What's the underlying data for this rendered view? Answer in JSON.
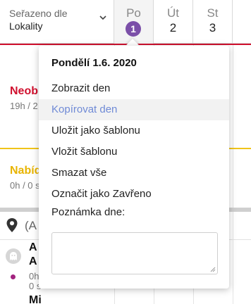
{
  "sort": {
    "label": "Seřazeno dle",
    "value": "Lokality"
  },
  "days": [
    {
      "name": "Po",
      "number": "1"
    },
    {
      "name": "Út",
      "number": "2"
    },
    {
      "name": "St",
      "number": "3"
    }
  ],
  "colors": {
    "accent_purple": "#7b4fa8",
    "red": "#d0102e",
    "yellow": "#f0c419",
    "menu_hover_text": "#6f8ad6"
  },
  "rows": {
    "red_title": "Neob",
    "red_sub": "19h / 2",
    "yellow_title": "Nabíd",
    "yellow_sub": "0h / 0 s"
  },
  "location": {
    "text": "(A"
  },
  "employee": {
    "name_line1": "A",
    "name_line2": "A",
    "sub1": "0h",
    "sub2": "0 s",
    "next_name": "Mi"
  },
  "menu": {
    "title": "Pondělí 1.6. 2020",
    "items": [
      "Zobrazit den",
      "Kopírovat den",
      "Uložit jako šablonu",
      "Vložit šablonu",
      "Smazat vše",
      "Označit jako Zavřeno"
    ],
    "note_label": "Poznámka dne:",
    "note_value": ""
  },
  "icons": [
    "chevron-down-icon",
    "map-pin-icon",
    "ghost-avatar-icon",
    "resize-grip-icon"
  ]
}
